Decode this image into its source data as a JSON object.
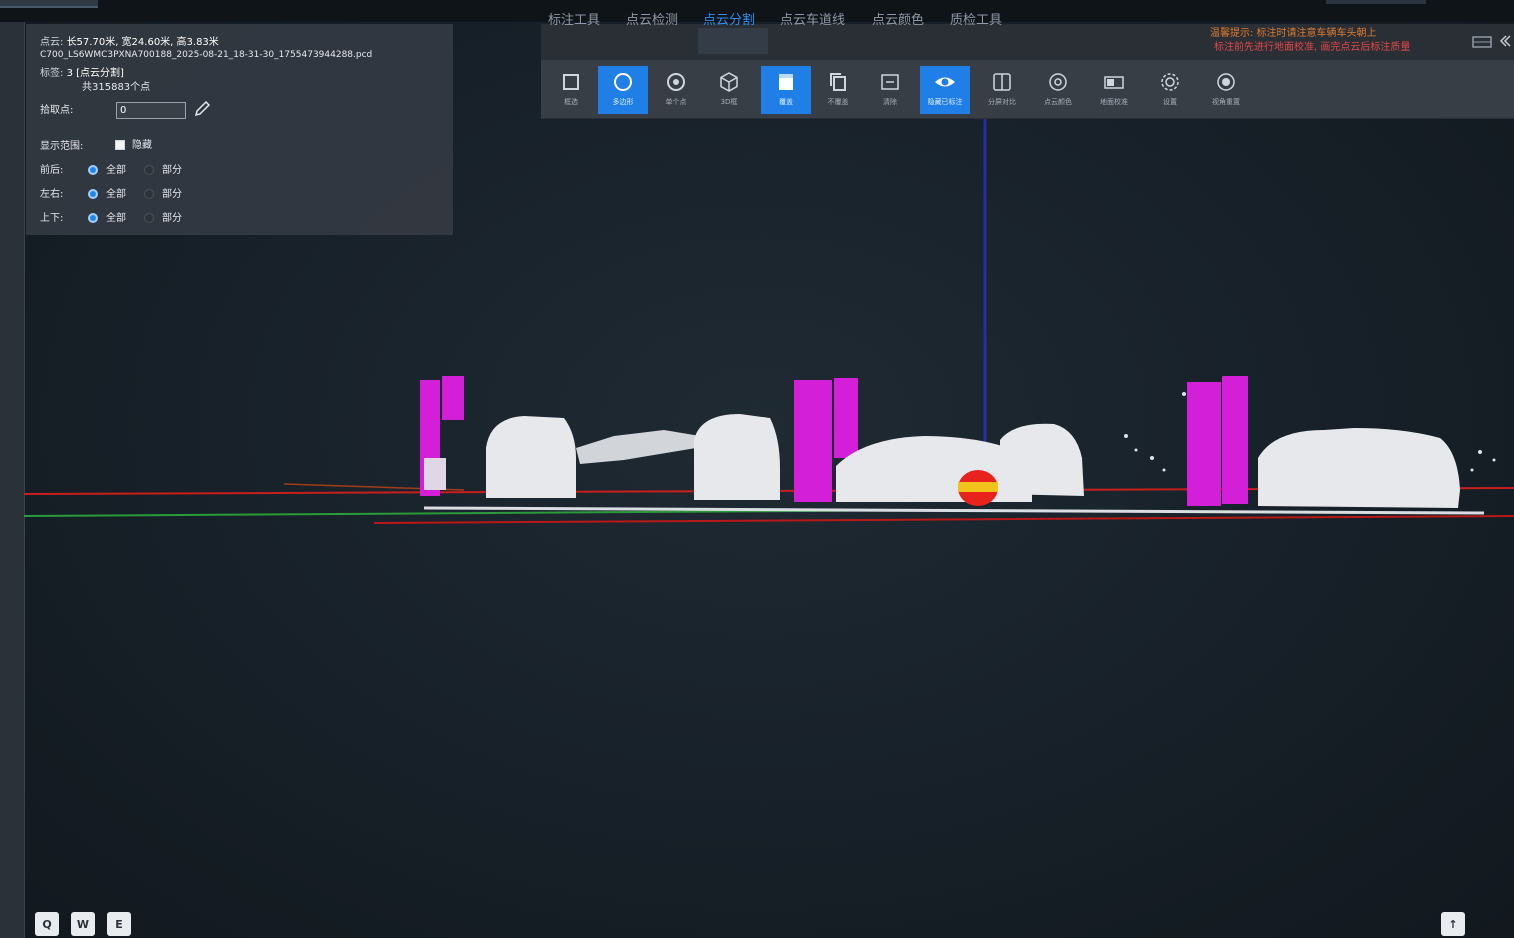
{
  "info": {
    "point_label": "点云:",
    "point_dims": "长57.70米, 宽24.60米, 高3.83米",
    "file_name": "C700_LS6WMC3PXNA700188_2025-08-21_18-31-30_1755473944288.pcd",
    "label_label": "标签:",
    "label_value": "3 [点云分割]",
    "point_count": "共315883个点",
    "pick_label": "拾取点:",
    "pick_value": "0",
    "display_label": "显示范围:",
    "hide_label": "隐藏",
    "ranges": [
      {
        "label": "前后:",
        "all": "全部",
        "part": "部分",
        "selected": "all"
      },
      {
        "label": "左右:",
        "all": "全部",
        "part": "部分",
        "selected": "all"
      },
      {
        "label": "上下:",
        "all": "全部",
        "part": "部分",
        "selected": "all"
      }
    ]
  },
  "tabs": [
    {
      "label": "标注工具",
      "active": false
    },
    {
      "label": "点云检测",
      "active": false
    },
    {
      "label": "点云分割",
      "active": true
    },
    {
      "label": "点云车道线",
      "active": false
    },
    {
      "label": "点云颜色",
      "active": false
    },
    {
      "label": "质检工具",
      "active": false
    }
  ],
  "warning": {
    "line1": "温馨提示: 标注时请注意车辆车头朝上",
    "line2": "标注前先进行地面校准, 画完点云后标注质量"
  },
  "tools": [
    {
      "label": "框选",
      "icon": "square-select-icon",
      "active": false
    },
    {
      "label": "多边形",
      "icon": "circle-select-icon",
      "active": true
    },
    {
      "label": "单个点",
      "icon": "target-point-icon",
      "active": false
    },
    {
      "label": "3D框",
      "icon": "cube-icon",
      "active": false
    },
    {
      "label": "覆盖",
      "icon": "overwrite-icon",
      "active": true
    },
    {
      "label": "不覆盖",
      "icon": "copy-icon",
      "active": false
    },
    {
      "label": "清除",
      "icon": "clear-icon",
      "active": false
    },
    {
      "label": "隐藏已标注",
      "icon": "eye-icon",
      "active": true
    },
    {
      "label": "分屏对比",
      "icon": "split-view-icon",
      "active": false
    },
    {
      "label": "点云颜色",
      "icon": "color-icon",
      "active": false
    },
    {
      "label": "地面校准",
      "icon": "ground-icon",
      "active": false
    },
    {
      "label": "设置",
      "icon": "settings-icon",
      "active": false
    },
    {
      "label": "视角重置",
      "icon": "reset-view-icon",
      "active": false
    }
  ],
  "bottom": {
    "left_buttons": [
      "Q",
      "W",
      "E"
    ],
    "right_button": "↑"
  },
  "colors": {
    "accent": "#1f7fe6",
    "segment": "#d41fd9",
    "points": "#e8eaee",
    "warning_orange": "#e07b2e",
    "warning_red": "#e24747"
  }
}
